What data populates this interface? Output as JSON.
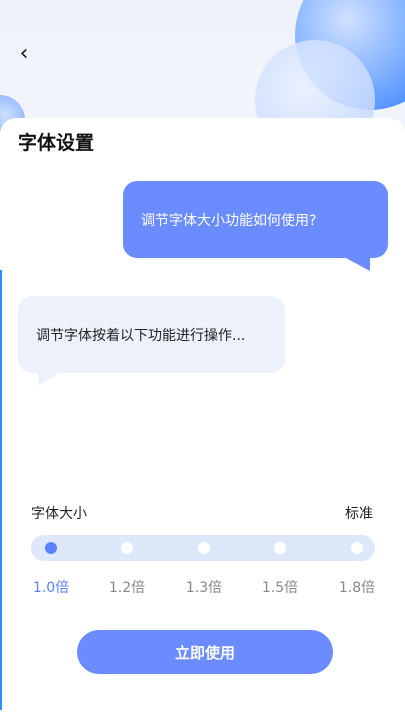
{
  "header": {
    "back_icon": "chevron-left-icon",
    "back_glyph": "‹"
  },
  "page": {
    "title": "字体设置"
  },
  "chat": {
    "question": "调节字体大小功能如何使用?",
    "answer": "调节字体按着以下功能进行操作..."
  },
  "font_size": {
    "label": "字体大小",
    "current_value": "标准",
    "options": [
      "1.0倍",
      "1.2倍",
      "1.3倍",
      "1.5倍",
      "1.8倍"
    ],
    "selected_index": 0
  },
  "actions": {
    "apply_label": "立即使用"
  },
  "colors": {
    "accent": "#6b8cff",
    "track": "#dde8fb",
    "bubble_light": "#edf1fb"
  }
}
